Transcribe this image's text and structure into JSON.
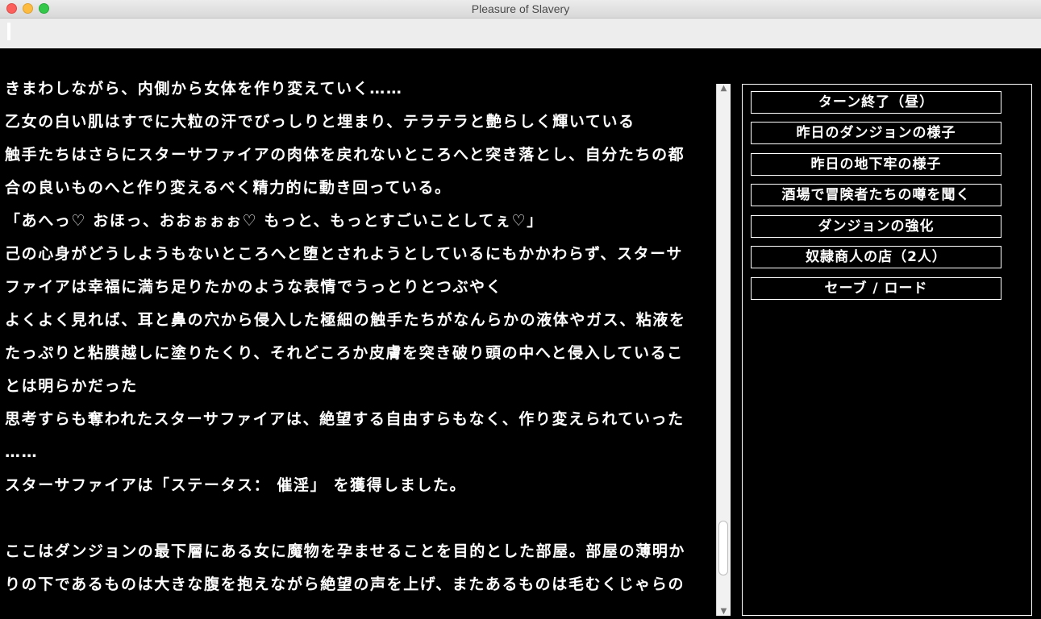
{
  "window": {
    "title": "Pleasure of Slavery"
  },
  "story": {
    "lines": [
      "きまわしながら、内側から女体を作り変えていく……",
      "乙女の白い肌はすでに大粒の汗でびっしりと埋まり、テラテラと艶らしく輝いている",
      "触手たちはさらにスターサファイアの肉体を戻れないところへと突き落とし、自分たちの都",
      "合の良いものへと作り変えるべく精力的に動き回っている。",
      "「あへっ♡ おほっ、おおぉぉぉ♡ もっと、もっとすごいことしてぇ♡」",
      "己の心身がどうしようもないところへと堕とされようとしているにもかかわらず、スターサ",
      "ファイアは幸福に満ち足りたかのような表情でうっとりとつぶやく",
      "よくよく見れば、耳と鼻の穴から侵入した極細の触手たちがなんらかの液体やガス、粘液を",
      "たっぷりと粘膜越しに塗りたくり、それどころか皮膚を突き破り頭の中へと侵入しているこ",
      "とは明らかだった",
      "思考すらも奪われたスターサファイアは、絶望する自由すらもなく、作り変えられていった",
      "……",
      "スターサファイアは「ステータス： 催淫」 を獲得しました。",
      "",
      "ここはダンジョンの最下層にある女に魔物を孕ませることを目的とした部屋。部屋の薄明か",
      "りの下であるものは大きな腹を抱えながら絶望の声を上げ、またあるものは毛むくじゃらの"
    ]
  },
  "menu": {
    "buttons": [
      "ターン終了（昼）",
      "昨日のダンジョンの様子",
      "昨日の地下牢の様子",
      "酒場で冒険者たちの噂を聞く",
      "ダンジョンの強化",
      "奴隷商人の店（2人）",
      "セーブ / ロード"
    ]
  },
  "colors": {
    "background": "#000000",
    "text": "#ffffff",
    "titlebar": "#e6e6e6",
    "input_bar": "#ededed"
  }
}
